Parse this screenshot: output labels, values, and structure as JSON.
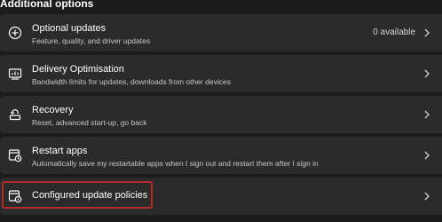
{
  "section": {
    "title": "Additional options"
  },
  "items": [
    {
      "title": "Optional updates",
      "subtitle": "Feature, quality, and driver updates",
      "trailing": "0 available",
      "icon": "plus-circle-icon"
    },
    {
      "title": "Delivery Optimisation",
      "subtitle": "Bandwidth limits for updates, downloads from other devices",
      "icon": "delivery-optimisation-icon"
    },
    {
      "title": "Recovery",
      "subtitle": "Reset, advanced start-up, go back",
      "icon": "recovery-icon"
    },
    {
      "title": "Restart apps",
      "subtitle": "Automatically save my restartable apps when I sign out and restart them after I sign in",
      "icon": "restart-apps-icon"
    },
    {
      "title": "Configured update policies",
      "icon": "policy-icon"
    }
  ],
  "colors": {
    "background": "#1c1c1c",
    "row": "#2b2b2b",
    "highlight": "#b22a2a"
  }
}
